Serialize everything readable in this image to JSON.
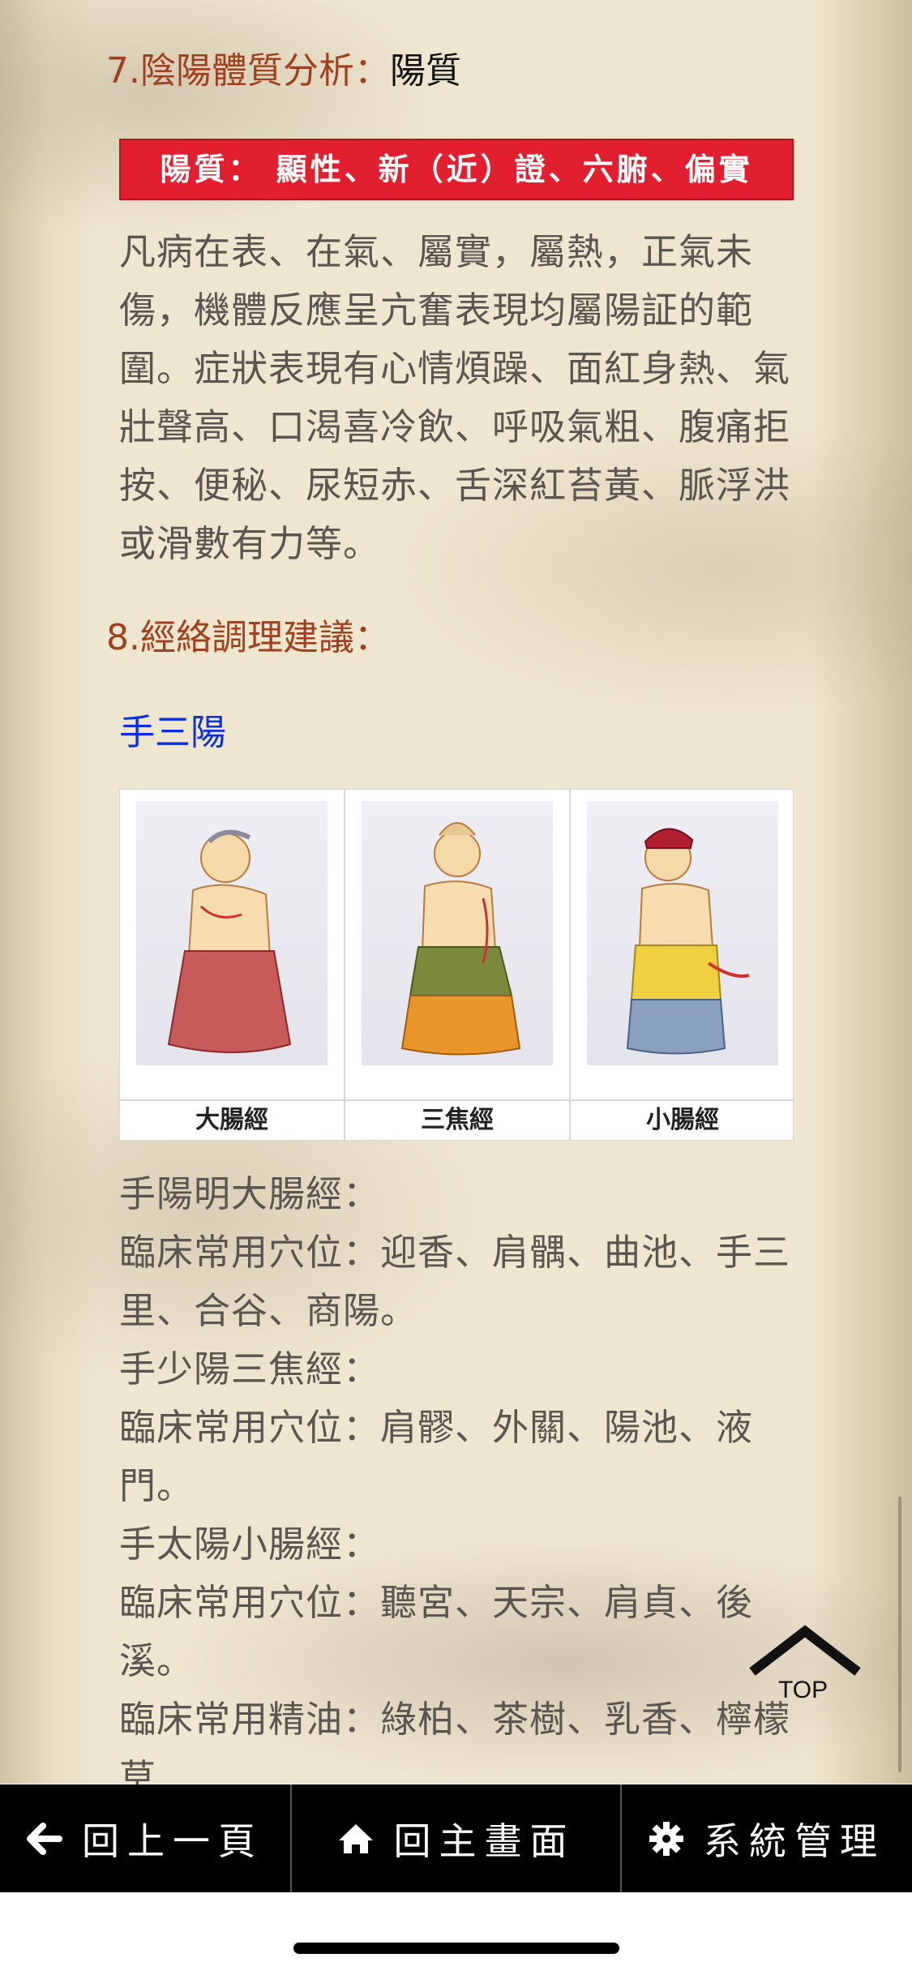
{
  "section7": {
    "label": "7.陰陽體質分析：",
    "value": "陽質",
    "banner": "陽質： 顯性、新（近）證、六腑、偏實",
    "description": "凡病在表、在氣、屬實，屬熱，正氣未傷，機體反應呈亢奮表現均屬陽証的範圍。症狀表現有心情煩躁、面紅身熱、氣壯聲高、口渴喜冷飲、呼吸氣粗、腹痛拒按、便秘、尿短赤、舌深紅苔黃、脈浮洪或滑數有力等。"
  },
  "section8": {
    "label": "8.經絡調理建議：",
    "subheading": "手三陽",
    "figure": {
      "captions": [
        "大腸經",
        "三焦經",
        "小腸經"
      ]
    },
    "meridians": [
      {
        "name": "手陽明大腸經：",
        "acupoints": "臨床常用穴位：迎香、肩髃、曲池、手三里、合谷、商陽。"
      },
      {
        "name": "手少陽三焦經：",
        "acupoints": "臨床常用穴位：肩髎、外關、陽池、液門。"
      },
      {
        "name": "手太陽小腸經：",
        "acupoints": "臨床常用穴位：聽宮、天宗、肩貞、後溪。"
      }
    ],
    "oils": "臨床常用精油：綠柏、茶樹、乳香、檸檬草"
  },
  "top_button": {
    "label": "TOP",
    "icon": "chevron-up-icon"
  },
  "bottom_nav": {
    "back": {
      "label": "回上一頁",
      "icon": "arrow-left-icon"
    },
    "home": {
      "label": "回主畫面",
      "icon": "home-icon"
    },
    "settings": {
      "label": "系統管理",
      "icon": "gear-icon"
    }
  }
}
